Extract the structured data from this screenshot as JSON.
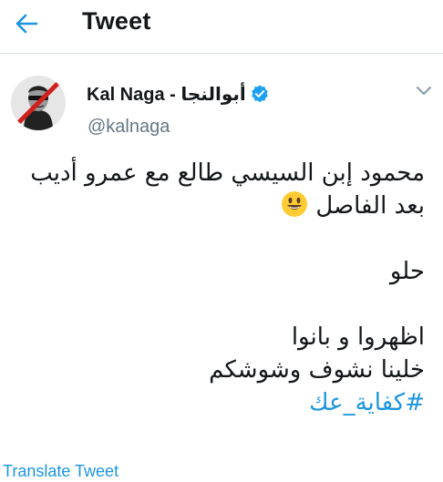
{
  "header": {
    "back_icon": "arrow-left-icon",
    "title": "Tweet"
  },
  "tweet": {
    "display_name": "Kal Naga - أبوالنجا",
    "verified_icon": "verified-badge-icon",
    "handle": "@kalnaga",
    "menu_icon": "chevron-down-icon",
    "lines": {
      "l1": "محمود إبن السيسي طالع مع عمرو أديب",
      "l2": "بعد الفاصل",
      "l3": "حلو",
      "l4": "اظهروا و بانوا",
      "l5": "خلينا نشوف وشوشكم",
      "hashtag": "#كفاية_عك"
    },
    "emoji": "smiling-face-icon",
    "translate_label": "Translate Tweet"
  },
  "colors": {
    "accent": "#1b95e0",
    "text": "#14171a",
    "secondary": "#657786"
  }
}
